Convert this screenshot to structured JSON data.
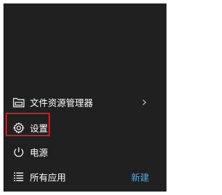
{
  "start_menu": {
    "items": [
      {
        "label": "文件资源管理器",
        "icon": "folder-explorer-icon",
        "has_submenu": true
      },
      {
        "label": "设置",
        "icon": "gear-icon",
        "highlighted": true
      },
      {
        "label": "电源",
        "icon": "power-icon"
      },
      {
        "label": "所有应用",
        "icon": "all-apps-list-icon"
      }
    ],
    "new_label": "新建"
  },
  "colors": {
    "panel_background": "#202020",
    "text": "#ffffff",
    "accent_link": "#4ea6e6",
    "highlight_border": "#e81123"
  }
}
